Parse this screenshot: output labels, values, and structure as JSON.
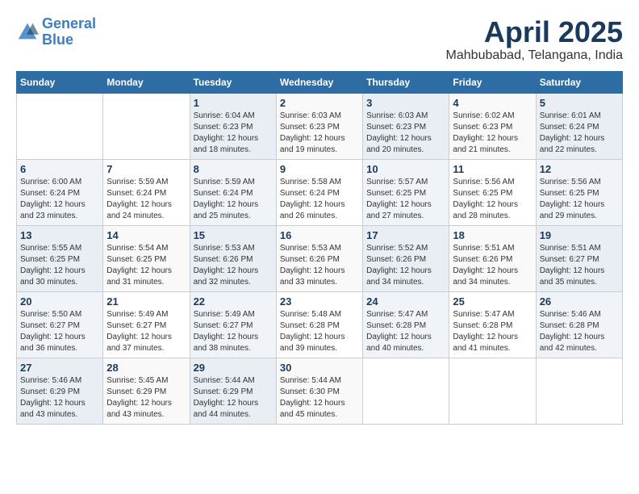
{
  "logo": {
    "line1": "General",
    "line2": "Blue"
  },
  "title": "April 2025",
  "location": "Mahbubabad, Telangana, India",
  "days_of_week": [
    "Sunday",
    "Monday",
    "Tuesday",
    "Wednesday",
    "Thursday",
    "Friday",
    "Saturday"
  ],
  "weeks": [
    [
      {
        "day": "",
        "info": ""
      },
      {
        "day": "",
        "info": ""
      },
      {
        "day": "1",
        "info": "Sunrise: 6:04 AM\nSunset: 6:23 PM\nDaylight: 12 hours and 18 minutes."
      },
      {
        "day": "2",
        "info": "Sunrise: 6:03 AM\nSunset: 6:23 PM\nDaylight: 12 hours and 19 minutes."
      },
      {
        "day": "3",
        "info": "Sunrise: 6:03 AM\nSunset: 6:23 PM\nDaylight: 12 hours and 20 minutes."
      },
      {
        "day": "4",
        "info": "Sunrise: 6:02 AM\nSunset: 6:23 PM\nDaylight: 12 hours and 21 minutes."
      },
      {
        "day": "5",
        "info": "Sunrise: 6:01 AM\nSunset: 6:24 PM\nDaylight: 12 hours and 22 minutes."
      }
    ],
    [
      {
        "day": "6",
        "info": "Sunrise: 6:00 AM\nSunset: 6:24 PM\nDaylight: 12 hours and 23 minutes."
      },
      {
        "day": "7",
        "info": "Sunrise: 5:59 AM\nSunset: 6:24 PM\nDaylight: 12 hours and 24 minutes."
      },
      {
        "day": "8",
        "info": "Sunrise: 5:59 AM\nSunset: 6:24 PM\nDaylight: 12 hours and 25 minutes."
      },
      {
        "day": "9",
        "info": "Sunrise: 5:58 AM\nSunset: 6:24 PM\nDaylight: 12 hours and 26 minutes."
      },
      {
        "day": "10",
        "info": "Sunrise: 5:57 AM\nSunset: 6:25 PM\nDaylight: 12 hours and 27 minutes."
      },
      {
        "day": "11",
        "info": "Sunrise: 5:56 AM\nSunset: 6:25 PM\nDaylight: 12 hours and 28 minutes."
      },
      {
        "day": "12",
        "info": "Sunrise: 5:56 AM\nSunset: 6:25 PM\nDaylight: 12 hours and 29 minutes."
      }
    ],
    [
      {
        "day": "13",
        "info": "Sunrise: 5:55 AM\nSunset: 6:25 PM\nDaylight: 12 hours and 30 minutes."
      },
      {
        "day": "14",
        "info": "Sunrise: 5:54 AM\nSunset: 6:25 PM\nDaylight: 12 hours and 31 minutes."
      },
      {
        "day": "15",
        "info": "Sunrise: 5:53 AM\nSunset: 6:26 PM\nDaylight: 12 hours and 32 minutes."
      },
      {
        "day": "16",
        "info": "Sunrise: 5:53 AM\nSunset: 6:26 PM\nDaylight: 12 hours and 33 minutes."
      },
      {
        "day": "17",
        "info": "Sunrise: 5:52 AM\nSunset: 6:26 PM\nDaylight: 12 hours and 34 minutes."
      },
      {
        "day": "18",
        "info": "Sunrise: 5:51 AM\nSunset: 6:26 PM\nDaylight: 12 hours and 34 minutes."
      },
      {
        "day": "19",
        "info": "Sunrise: 5:51 AM\nSunset: 6:27 PM\nDaylight: 12 hours and 35 minutes."
      }
    ],
    [
      {
        "day": "20",
        "info": "Sunrise: 5:50 AM\nSunset: 6:27 PM\nDaylight: 12 hours and 36 minutes."
      },
      {
        "day": "21",
        "info": "Sunrise: 5:49 AM\nSunset: 6:27 PM\nDaylight: 12 hours and 37 minutes."
      },
      {
        "day": "22",
        "info": "Sunrise: 5:49 AM\nSunset: 6:27 PM\nDaylight: 12 hours and 38 minutes."
      },
      {
        "day": "23",
        "info": "Sunrise: 5:48 AM\nSunset: 6:28 PM\nDaylight: 12 hours and 39 minutes."
      },
      {
        "day": "24",
        "info": "Sunrise: 5:47 AM\nSunset: 6:28 PM\nDaylight: 12 hours and 40 minutes."
      },
      {
        "day": "25",
        "info": "Sunrise: 5:47 AM\nSunset: 6:28 PM\nDaylight: 12 hours and 41 minutes."
      },
      {
        "day": "26",
        "info": "Sunrise: 5:46 AM\nSunset: 6:28 PM\nDaylight: 12 hours and 42 minutes."
      }
    ],
    [
      {
        "day": "27",
        "info": "Sunrise: 5:46 AM\nSunset: 6:29 PM\nDaylight: 12 hours and 43 minutes."
      },
      {
        "day": "28",
        "info": "Sunrise: 5:45 AM\nSunset: 6:29 PM\nDaylight: 12 hours and 43 minutes."
      },
      {
        "day": "29",
        "info": "Sunrise: 5:44 AM\nSunset: 6:29 PM\nDaylight: 12 hours and 44 minutes."
      },
      {
        "day": "30",
        "info": "Sunrise: 5:44 AM\nSunset: 6:30 PM\nDaylight: 12 hours and 45 minutes."
      },
      {
        "day": "",
        "info": ""
      },
      {
        "day": "",
        "info": ""
      },
      {
        "day": "",
        "info": ""
      }
    ]
  ]
}
